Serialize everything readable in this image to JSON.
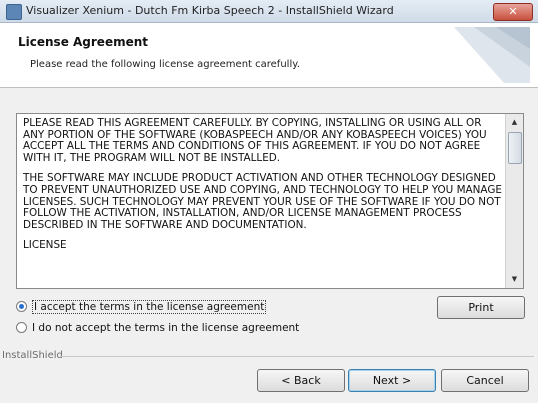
{
  "window": {
    "title": "Visualizer Xenium - Dutch Fm Kirba Speech 2 - InstallShield Wizard",
    "close_glyph": "✕"
  },
  "banner": {
    "title": "License Agreement",
    "subtitle": "Please read the following license agreement carefully."
  },
  "license": {
    "paragraphs": [
      "PLEASE READ THIS AGREEMENT CAREFULLY. BY COPYING, INSTALLING OR USING ALL OR ANY PORTION OF THE SOFTWARE (KOBASPEECH AND/OR ANY KOBASPEECH VOICES) YOU ACCEPT ALL THE TERMS AND CONDITIONS OF THIS AGREEMENT. IF YOU DO NOT AGREE WITH IT, THE PROGRAM WILL NOT BE INSTALLED.",
      "THE SOFTWARE MAY INCLUDE PRODUCT ACTIVATION AND OTHER TECHNOLOGY DESIGNED TO PREVENT UNAUTHORIZED USE AND COPYING, AND TECHNOLOGY TO HELP YOU MANAGE LICENSES. SUCH TECHNOLOGY MAY PREVENT YOUR USE OF THE SOFTWARE IF YOU DO NOT FOLLOW THE ACTIVATION, INSTALLATION, AND/OR LICENSE MANAGEMENT PROCESS DESCRIBED IN THE SOFTWARE AND DOCUMENTATION.",
      "LICENSE"
    ]
  },
  "options": {
    "accept_label": "I accept the terms in the license agreement",
    "decline_label": "I do not accept the terms in the license agreement",
    "selected": "accept"
  },
  "buttons": {
    "print": "Print",
    "back": "< Back",
    "next": "Next >",
    "cancel": "Cancel"
  },
  "footer": {
    "brand": "InstallShield"
  },
  "colors": {
    "accent": "#2a6fce",
    "close": "#c8503d"
  }
}
